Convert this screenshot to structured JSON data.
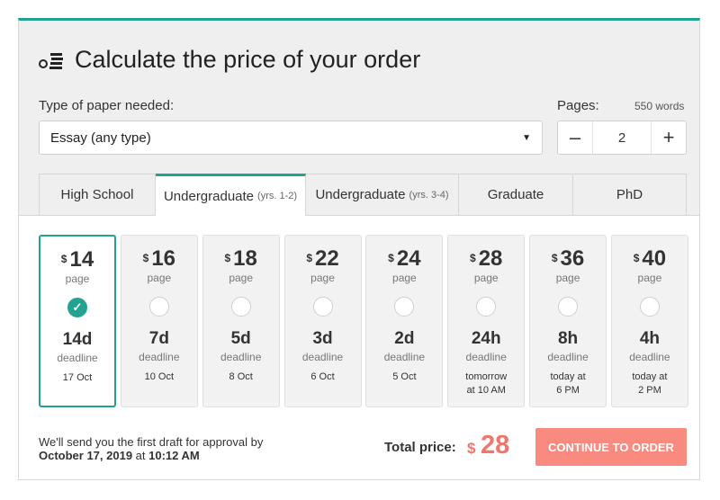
{
  "header": {
    "title": "Calculate the price of your order",
    "icon": "coins-calc-icon"
  },
  "paper_type": {
    "label": "Type of paper needed:",
    "value": "Essay (any type)"
  },
  "pages": {
    "label": "Pages:",
    "words": "550 words",
    "value": "2",
    "minus": "–",
    "plus": "+"
  },
  "tabs": [
    {
      "label": "High School",
      "sub": ""
    },
    {
      "label": "Undergraduate",
      "sub": "(yrs. 1-2)"
    },
    {
      "label": "Undergraduate",
      "sub": "(yrs. 3-4)"
    },
    {
      "label": "Graduate",
      "sub": ""
    },
    {
      "label": "PhD",
      "sub": ""
    }
  ],
  "active_tab": 1,
  "deadlines": [
    {
      "price": "14",
      "unit": "page",
      "days": "14d",
      "label": "deadline",
      "date": "17 Oct",
      "selected": true
    },
    {
      "price": "16",
      "unit": "page",
      "days": "7d",
      "label": "deadline",
      "date": "10 Oct",
      "selected": false
    },
    {
      "price": "18",
      "unit": "page",
      "days": "5d",
      "label": "deadline",
      "date": "8 Oct",
      "selected": false
    },
    {
      "price": "22",
      "unit": "page",
      "days": "3d",
      "label": "deadline",
      "date": "6 Oct",
      "selected": false
    },
    {
      "price": "24",
      "unit": "page",
      "days": "2d",
      "label": "deadline",
      "date": "5 Oct",
      "selected": false
    },
    {
      "price": "28",
      "unit": "page",
      "days": "24h",
      "label": "deadline",
      "date": "tomorrow\nat 10 AM",
      "selected": false
    },
    {
      "price": "36",
      "unit": "page",
      "days": "8h",
      "label": "deadline",
      "date": "today at\n6 PM",
      "selected": false
    },
    {
      "price": "40",
      "unit": "page",
      "days": "4h",
      "label": "deadline",
      "date": "today at\n2 PM",
      "selected": false
    }
  ],
  "currency": "$",
  "footer": {
    "note_line1": "We'll send you the first draft for approval by",
    "note_date": "October 17, 2019",
    "note_at": " at ",
    "note_time": "10:12 AM",
    "total_label": "Total price:",
    "total_currency": "$",
    "total_value": "28",
    "cta_label": "CONTINUE TO ORDER"
  },
  "colors": {
    "accent": "#22a38f",
    "cta": "#f98a7f",
    "price": "#f0766b"
  }
}
